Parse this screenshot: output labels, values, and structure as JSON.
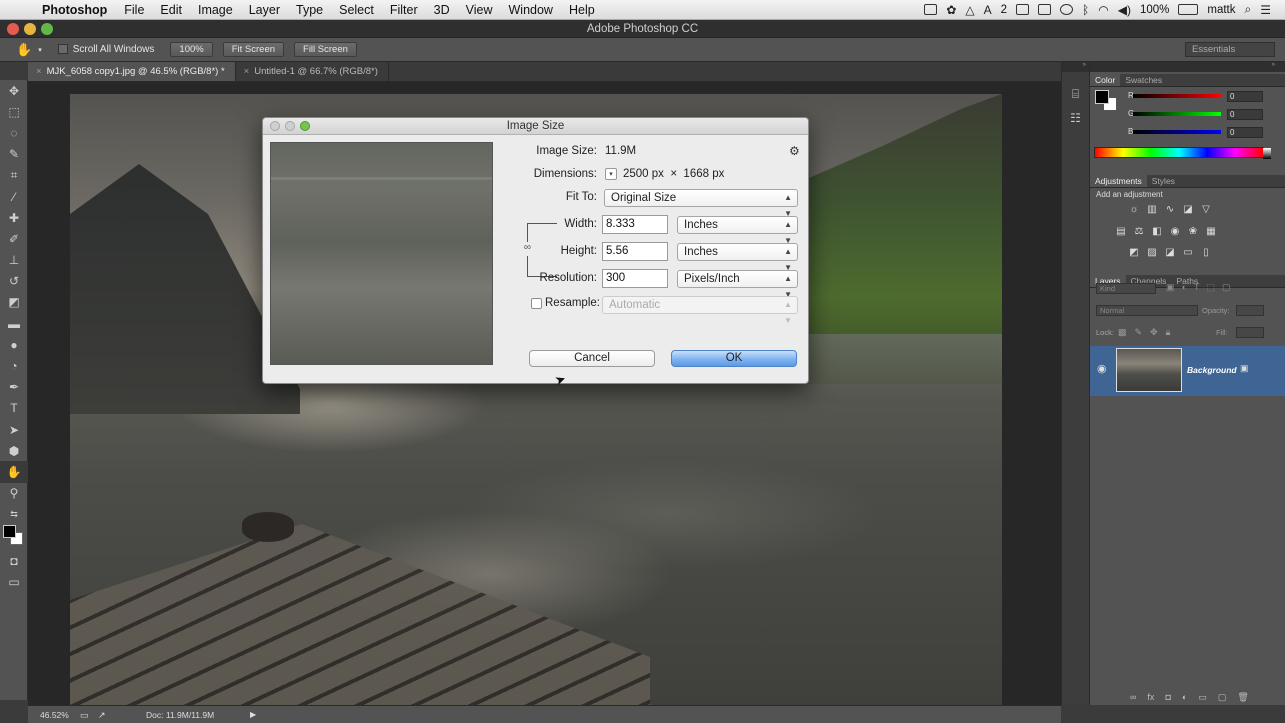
{
  "menubar": {
    "app_name": "Photoshop",
    "menus": [
      "File",
      "Edit",
      "Image",
      "Layer",
      "Type",
      "Select",
      "Filter",
      "3D",
      "View",
      "Window",
      "Help"
    ],
    "status_number": "2",
    "battery": "100%",
    "user": "mattk"
  },
  "window": {
    "title": "Adobe Photoshop CC"
  },
  "options": {
    "scroll_all_windows": "Scroll All Windows",
    "zoom_100": "100%",
    "fit_screen": "Fit Screen",
    "fill_screen": "Fill Screen",
    "workspace": "Essentials"
  },
  "tabs": [
    {
      "label": "MJK_6058 copy1.jpg @ 46.5% (RGB/8*) *"
    },
    {
      "label": "Untitled-1 @ 66.7% (RGB/8*)"
    }
  ],
  "dialog": {
    "title": "Image Size",
    "image_size_label": "Image Size:",
    "image_size_value": "11.9M",
    "dimensions_label": "Dimensions:",
    "dimensions_value": "2500 px  ×  1668 px",
    "fit_to_label": "Fit To:",
    "fit_to_value": "Original Size",
    "width_label": "Width:",
    "width_value": "8.333",
    "width_unit": "Inches",
    "height_label": "Height:",
    "height_value": "5.56",
    "height_unit": "Inches",
    "resolution_label": "Resolution:",
    "resolution_value": "300",
    "resolution_unit": "Pixels/Inch",
    "resample_label": "Resample:",
    "resample_value": "Automatic",
    "cancel": "Cancel",
    "ok": "OK"
  },
  "color_panel": {
    "tabs": [
      "Color",
      "Swatches"
    ],
    "r_label": "R",
    "g_label": "G",
    "b_label": "B",
    "r": "0",
    "g": "0",
    "b": "0"
  },
  "adjustments_panel": {
    "tabs": [
      "Adjustments",
      "Styles"
    ],
    "hint": "Add an adjustment"
  },
  "layers_panel": {
    "tabs": [
      "Layers",
      "Channels",
      "Paths"
    ],
    "kind": "Kind",
    "blend_mode": "Normal",
    "opacity_label": "Opacity:",
    "lock_label": "Lock:",
    "fill_label": "Fill:",
    "layer_name": "Background"
  },
  "statusbar": {
    "zoom": "46.52%",
    "doc": "Doc: 11.9M/11.9M"
  }
}
